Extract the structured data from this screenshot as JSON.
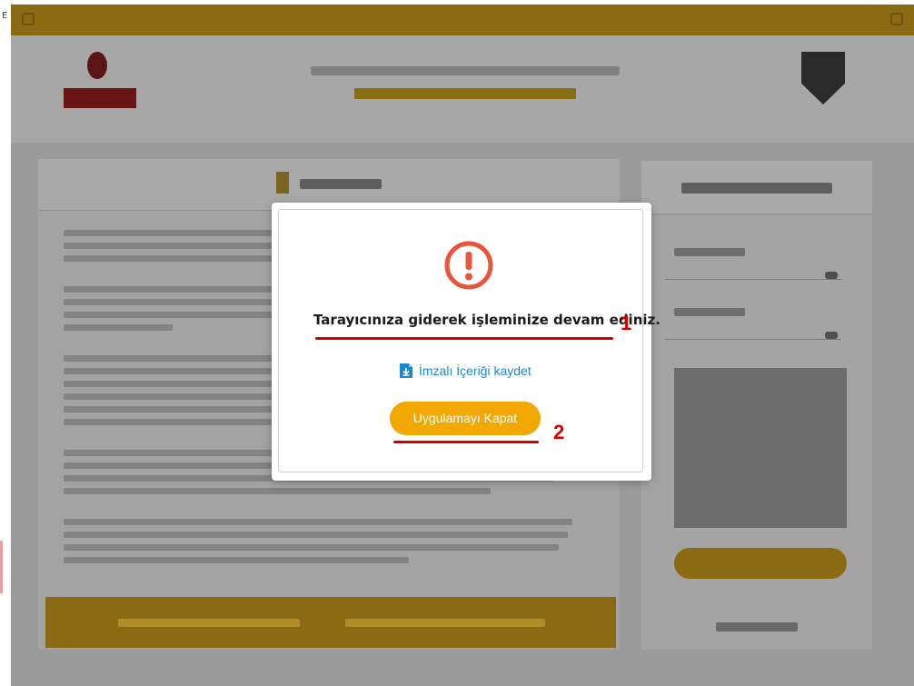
{
  "browser": {
    "left_letter": "E"
  },
  "dialog": {
    "icon": "exclamation-circle-icon",
    "message": "Tarayıcınıza giderek işleminize devam ediniz.",
    "save_icon": "download-file-icon",
    "save_link_label": "İmzalı İçeriği kaydet",
    "close_button_label": "Uygulamayı Kapat",
    "annotation_1": "1",
    "annotation_2": "2"
  },
  "colors": {
    "accent": "#f1a800",
    "annotation_red": "#d40000",
    "link_blue": "#1e88c8",
    "warning_icon": "#e8553a",
    "backdrop_gold": "#8a6a12"
  }
}
